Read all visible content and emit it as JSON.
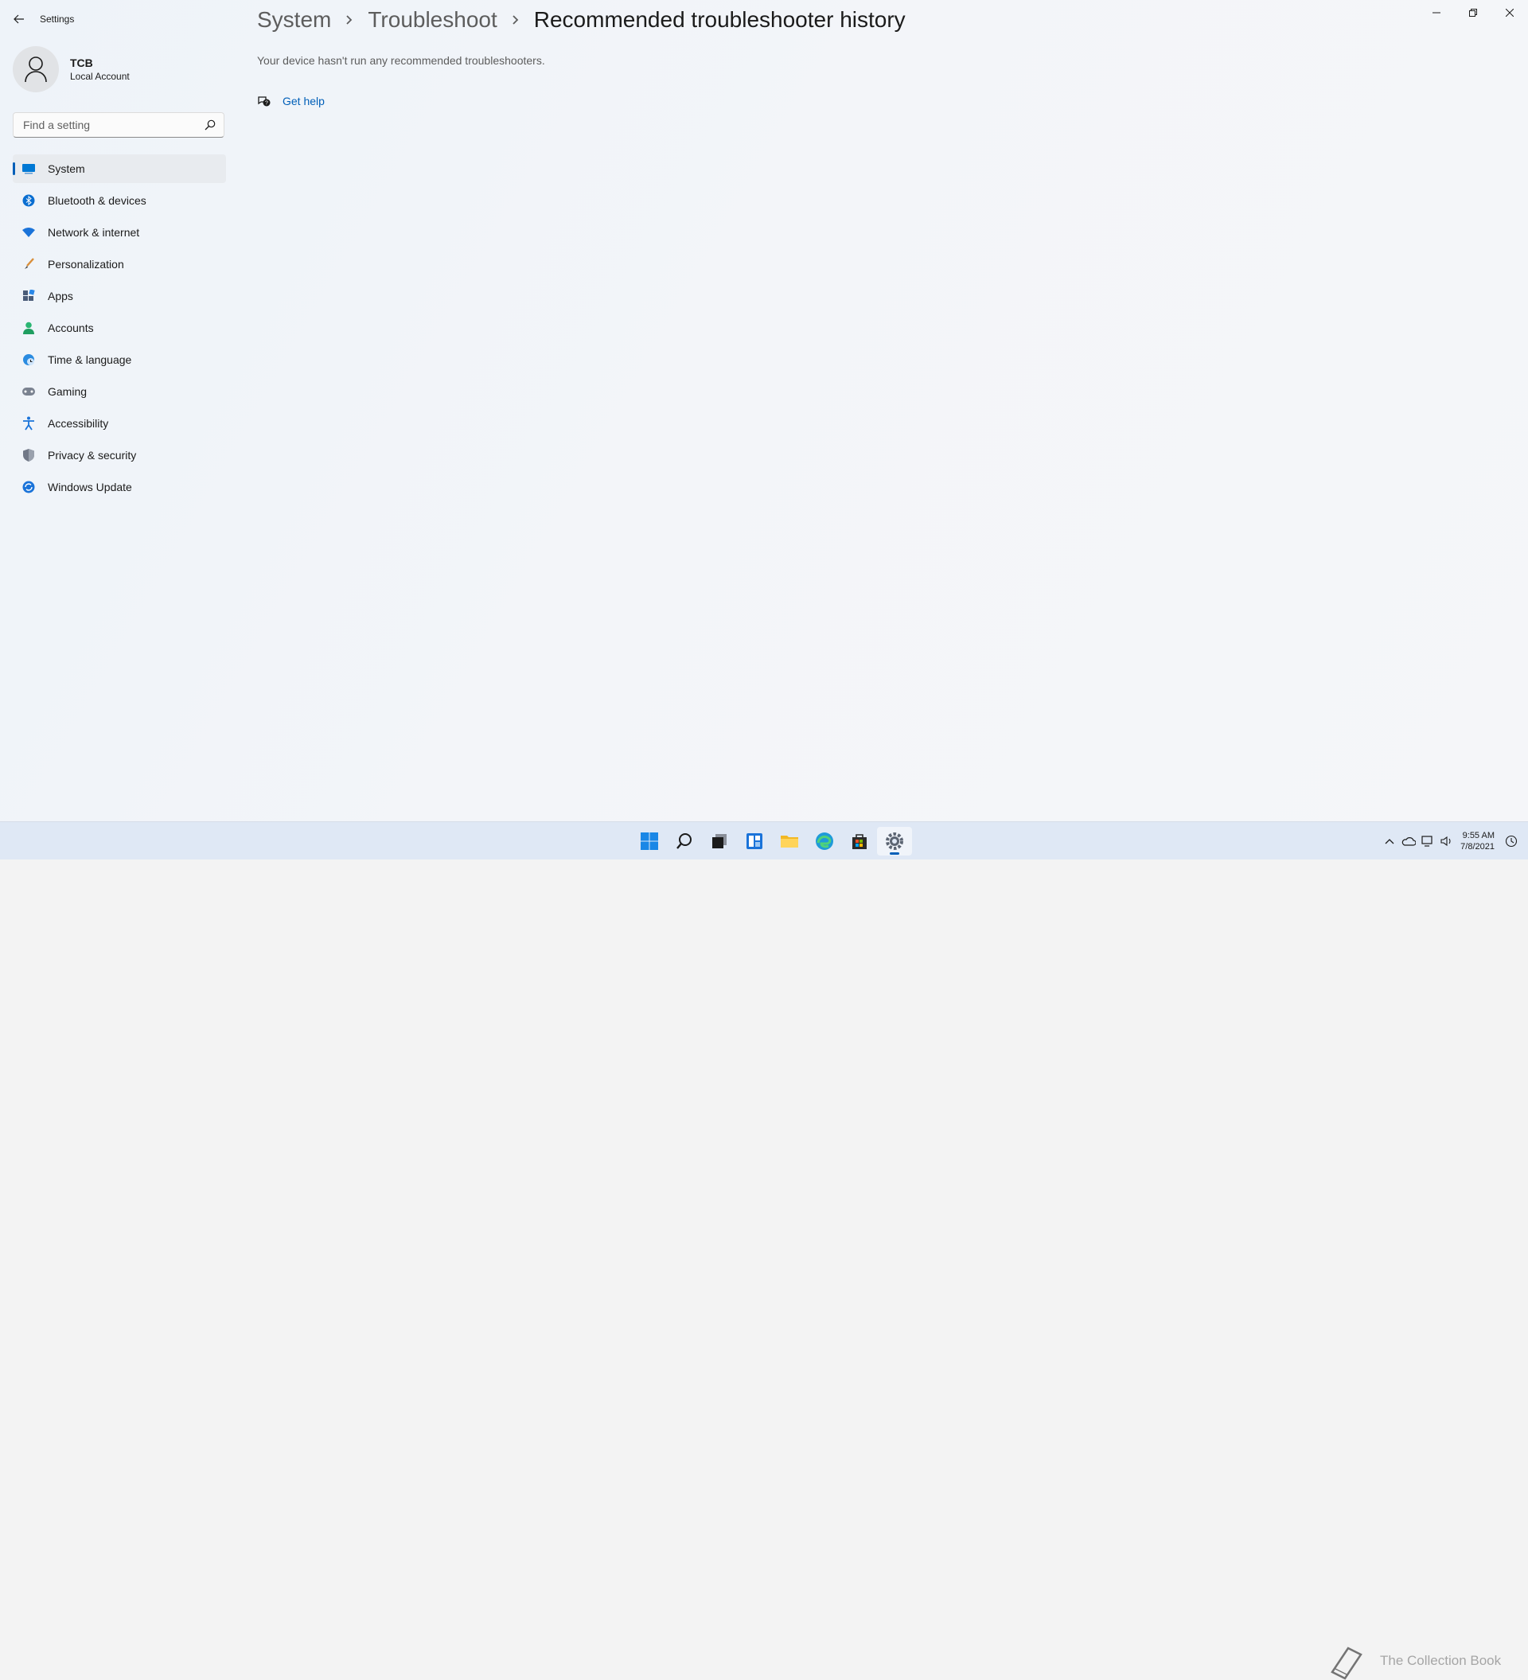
{
  "app": {
    "title": "Settings"
  },
  "profile": {
    "name": "TCB",
    "account_type": "Local Account"
  },
  "search": {
    "placeholder": "Find a setting"
  },
  "nav": {
    "items": [
      {
        "label": "System",
        "icon": "monitor-icon",
        "active": true
      },
      {
        "label": "Bluetooth & devices",
        "icon": "bluetooth-icon"
      },
      {
        "label": "Network & internet",
        "icon": "wifi-icon"
      },
      {
        "label": "Personalization",
        "icon": "brush-icon"
      },
      {
        "label": "Apps",
        "icon": "apps-icon"
      },
      {
        "label": "Accounts",
        "icon": "person-icon"
      },
      {
        "label": "Time & language",
        "icon": "globe-clock-icon"
      },
      {
        "label": "Gaming",
        "icon": "gamepad-icon"
      },
      {
        "label": "Accessibility",
        "icon": "accessibility-icon"
      },
      {
        "label": "Privacy & security",
        "icon": "shield-icon"
      },
      {
        "label": "Windows Update",
        "icon": "update-icon"
      }
    ]
  },
  "breadcrumb": {
    "items": [
      "System",
      "Troubleshoot"
    ],
    "current": "Recommended troubleshooter history"
  },
  "content": {
    "info_text": "Your device hasn't run any recommended troubleshooters.",
    "get_help_label": "Get help"
  },
  "taskbar": {
    "apps": [
      "start-icon",
      "search-icon",
      "task-view-icon",
      "widgets-icon",
      "file-explorer-icon",
      "edge-icon",
      "store-icon",
      "settings-icon"
    ],
    "active_app": "settings-icon",
    "watermark_text": "The Collection Book",
    "clock": {
      "time": "9:55 AM",
      "date": "7/8/2021"
    }
  },
  "colors": {
    "accent": "#005fb8",
    "background": "#f3f3f3"
  }
}
